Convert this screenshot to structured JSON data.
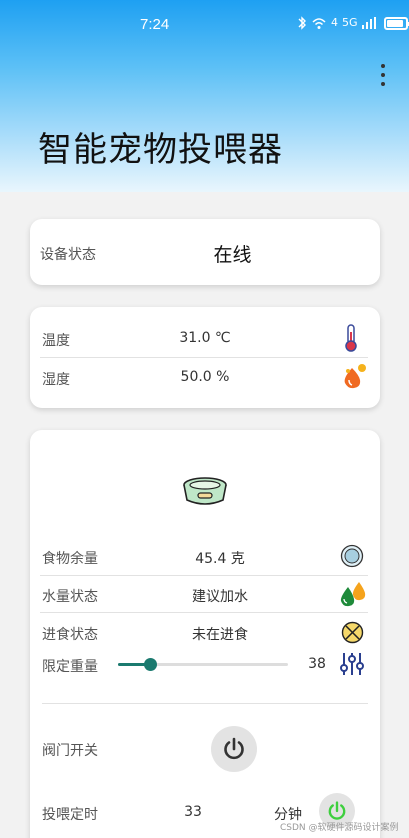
{
  "status_bar": {
    "time": "7:24",
    "network_badge": "4",
    "network_label": "5G"
  },
  "app": {
    "title": "智能宠物投喂器"
  },
  "device_card": {
    "label": "设备状态",
    "value": "在线"
  },
  "env_card": {
    "temperature_label": "温度",
    "temperature_value": "31.0 ℃",
    "humidity_label": "湿度",
    "humidity_value": "50.0 %"
  },
  "feeder_card": {
    "food_label": "食物余量",
    "food_value": "45.4 克",
    "water_label": "水量状态",
    "water_value": "建议加水",
    "eating_label": "进食状态",
    "eating_value": "未在进食",
    "limit_label": "限定重量",
    "limit_value": "38",
    "limit_fraction": 0.19,
    "valve_label": "阀门开关",
    "timer_label": "投喂定时",
    "timer_value": "33",
    "timer_unit": "分钟"
  },
  "watermark": "CSDN @软硬件源码设计案例",
  "colors": {
    "accent": "#1b7a6f",
    "header_top": "#1ea0f2",
    "power_green": "#3ecf3e"
  }
}
